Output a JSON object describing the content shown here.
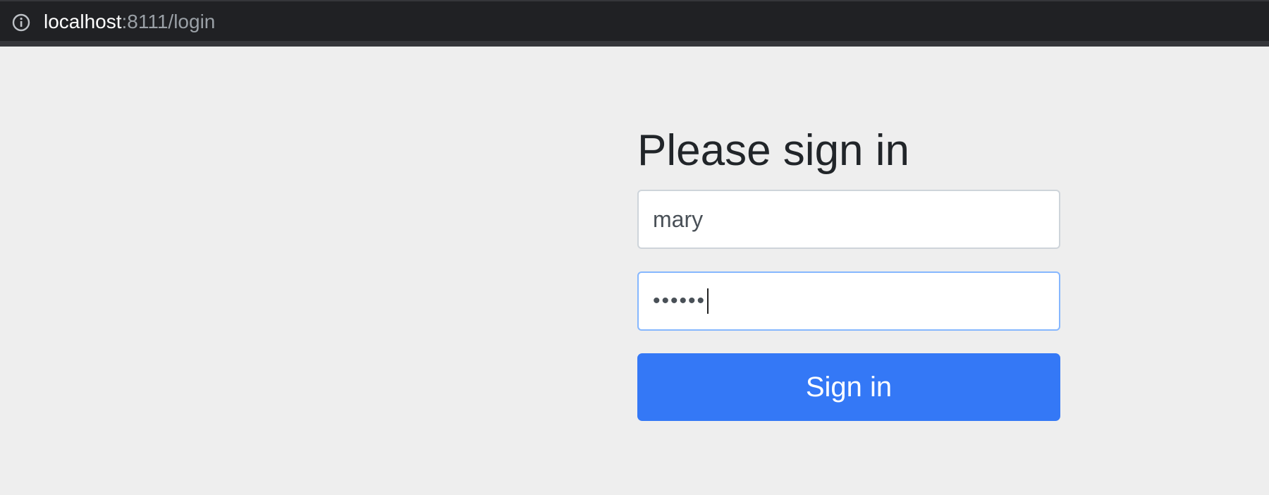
{
  "browser": {
    "url_host": "localhost",
    "url_rest": ":8111/login",
    "info_icon": "info-icon"
  },
  "form": {
    "heading": "Please sign in",
    "username_value": "mary",
    "password_masked": "••••••",
    "submit_label": "Sign in"
  },
  "colors": {
    "page_bg": "#eeeeee",
    "browser_bar": "#202124",
    "button": "#3478f6",
    "focus_border": "#86b7fe"
  }
}
